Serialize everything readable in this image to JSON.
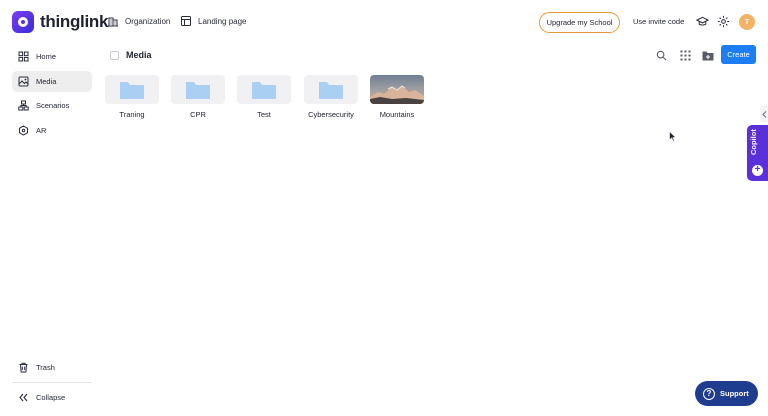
{
  "app": {
    "logo_text": "thinglink"
  },
  "topnav": {
    "organization": "Organization",
    "landing_page": "Landing page",
    "upgrade": "Upgrade my School",
    "invite": "Use invite code",
    "avatar_initial": "T"
  },
  "sidebar": {
    "items": [
      {
        "label": "Home",
        "icon": "home-icon"
      },
      {
        "label": "Media",
        "icon": "media-icon",
        "active": true
      },
      {
        "label": "Scenarios",
        "icon": "scenarios-icon"
      },
      {
        "label": "AR",
        "icon": "ar-icon"
      }
    ],
    "trash": "Trash",
    "collapse": "Collapse"
  },
  "content": {
    "title": "Media",
    "create": "Create",
    "items": [
      {
        "label": "Traning",
        "type": "folder"
      },
      {
        "label": "CPR",
        "type": "folder"
      },
      {
        "label": "Test",
        "type": "folder"
      },
      {
        "label": "Cybersecurity",
        "type": "folder"
      },
      {
        "label": "Mountains",
        "type": "image"
      }
    ]
  },
  "copilot": {
    "label": "Copilot"
  },
  "support": {
    "label": "Support"
  },
  "colors": {
    "accent": "#1c7ef2",
    "brand": "#5a30d8",
    "folder": "#a9cff3",
    "support": "#1f3d8f",
    "upgrade_border": "#e29a3a"
  }
}
